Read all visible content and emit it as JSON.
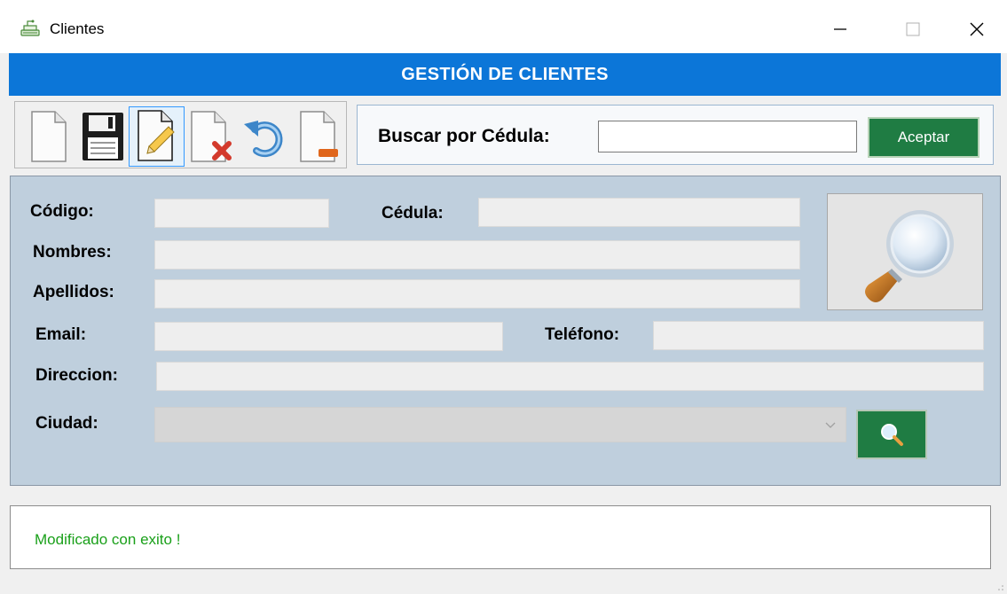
{
  "window": {
    "title": "Clientes",
    "icon": "app-tray-icon"
  },
  "titlebar_buttons": [
    "minimize-icon",
    "maximize-icon",
    "close-icon"
  ],
  "header": {
    "title": "GESTIÓN DE CLIENTES",
    "color": "#0c76d8"
  },
  "toolbar": {
    "buttons": [
      {
        "name": "new",
        "icon": "new-document-icon"
      },
      {
        "name": "save",
        "icon": "floppy-save-icon"
      },
      {
        "name": "edit",
        "icon": "edit-pencil-icon",
        "selected": true
      },
      {
        "name": "delete",
        "icon": "delete-document-icon"
      },
      {
        "name": "undo",
        "icon": "undo-arrow-icon"
      },
      {
        "name": "remove",
        "icon": "document-minus-icon"
      }
    ]
  },
  "search": {
    "label": "Buscar por Cédula:",
    "value": "",
    "button_label": "Aceptar",
    "button_color": "#1f7c43"
  },
  "form": {
    "codigo_label": "Código:",
    "codigo_value": "",
    "cedula_label": "Cédula:",
    "cedula_value": "",
    "nombres_label": "Nombres:",
    "nombres_value": "",
    "apellidos_label": "Apellidos:",
    "apellidos_value": "",
    "email_label": "Email:",
    "email_value": "",
    "telefono_label": "Teléfono:",
    "telefono_value": "",
    "direccion_label": "Direccion:",
    "direccion_value": "",
    "ciudad_label": "Ciudad:",
    "ciudad_value": "",
    "panel_color": "#bfcfdd"
  },
  "status": {
    "message": "Modificado con exito !",
    "color": "#1aa01a"
  }
}
